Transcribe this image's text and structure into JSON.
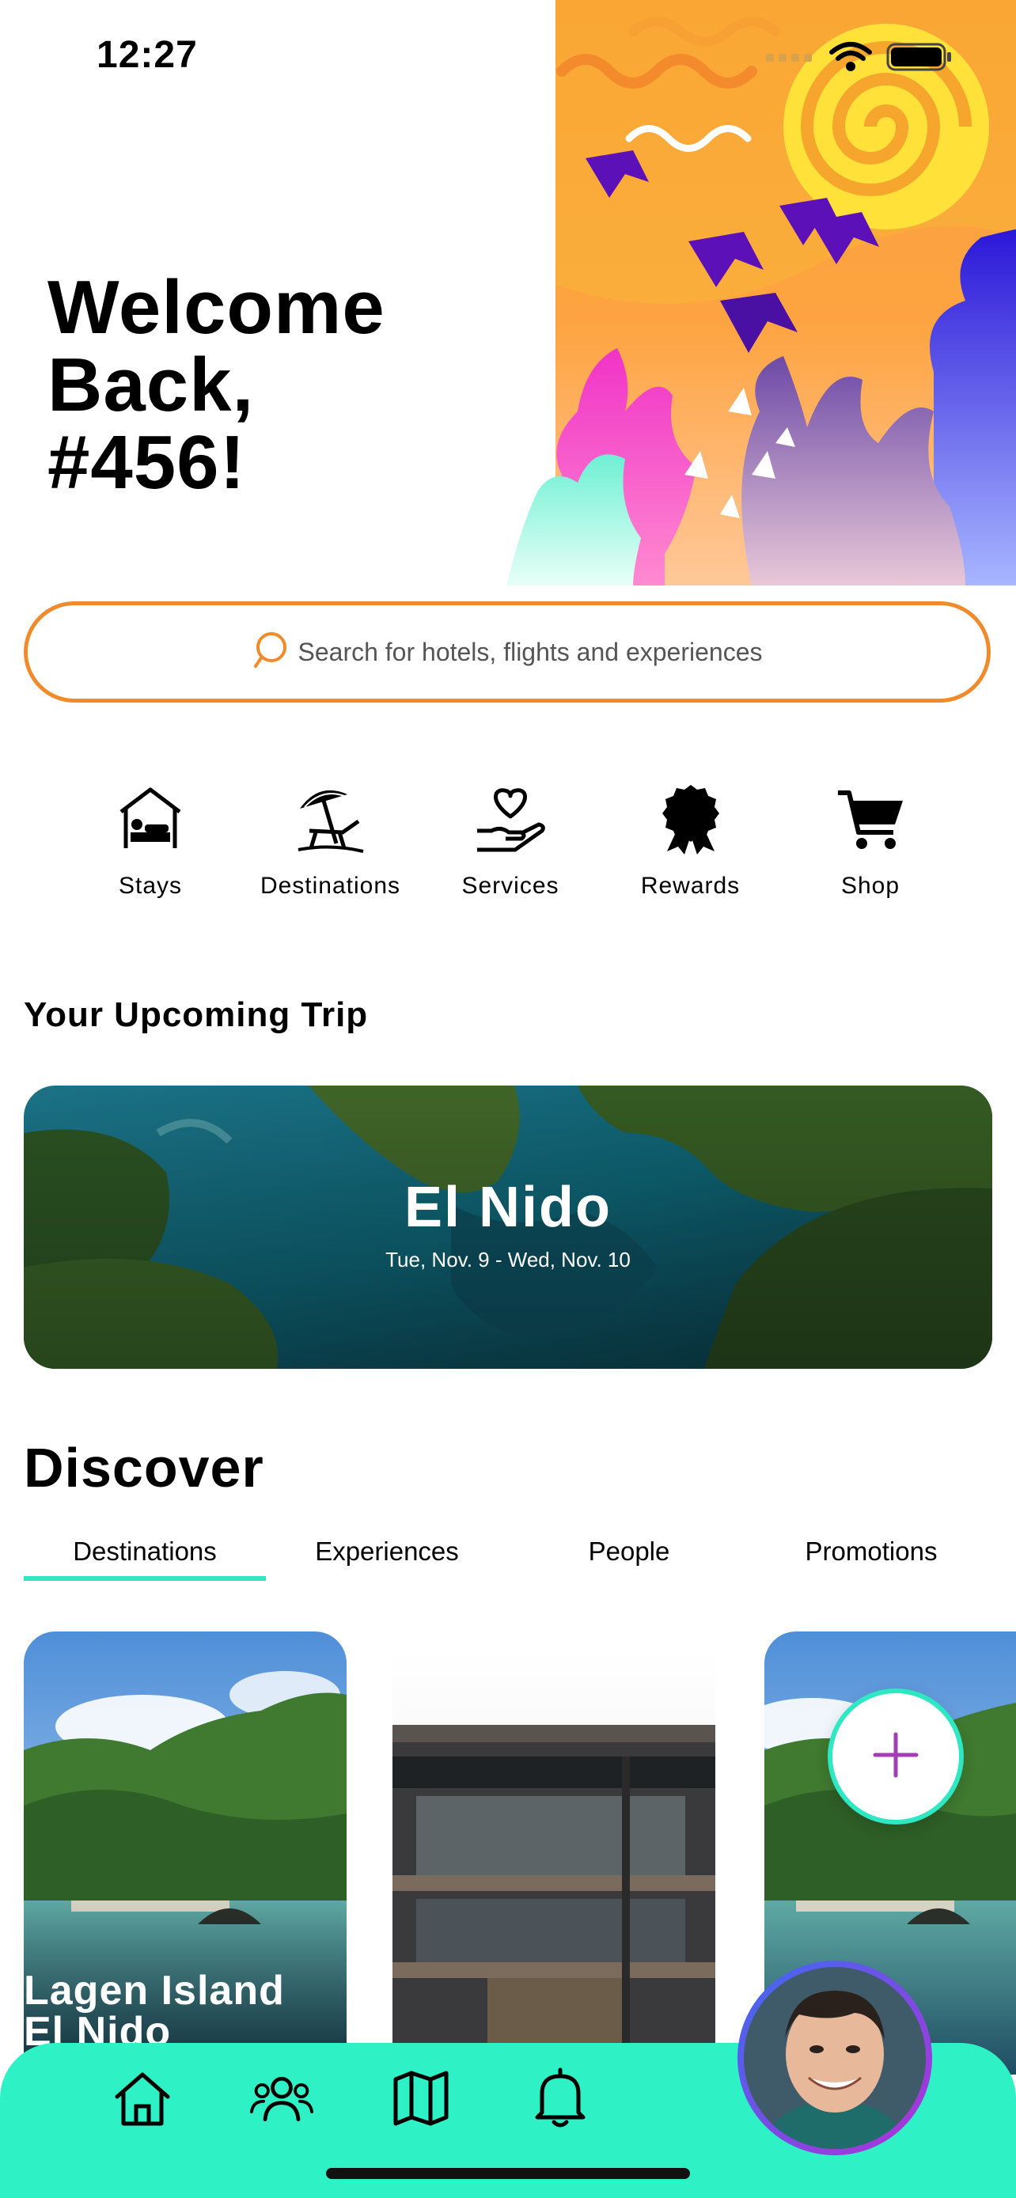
{
  "status_bar": {
    "time": "12:27"
  },
  "header": {
    "welcome_line1": "Welcome",
    "welcome_line2": "Back,",
    "welcome_line3": "#456!"
  },
  "search": {
    "placeholder": "Search for hotels, flights and experiences"
  },
  "categories": [
    {
      "label": "Stays",
      "icon": "bed-house-icon"
    },
    {
      "label": "Destinations",
      "icon": "beach-umbrella-icon"
    },
    {
      "label": "Services",
      "icon": "heart-hand-icon"
    },
    {
      "label": "Rewards",
      "icon": "award-ribbon-icon"
    },
    {
      "label": "Shop",
      "icon": "cart-icon"
    }
  ],
  "upcoming": {
    "section_title": "Your Upcoming Trip",
    "destination": "El Nido",
    "dates": "Tue, Nov. 9 - Wed, Nov. 10"
  },
  "discover": {
    "title": "Discover",
    "tabs": [
      "Destinations",
      "Experiences",
      "People",
      "Promotions"
    ],
    "active_tab": "Destinations",
    "cards": [
      {
        "title_line1": "Lagen Island",
        "title_line2": "El Nido"
      }
    ]
  },
  "tab_bar": {
    "icons": [
      "home-icon",
      "people-icon",
      "map-icon",
      "bell-icon"
    ]
  },
  "colors": {
    "accent_orange": "#f08a2a",
    "accent_teal": "#2ef2c6",
    "active_tab_underline": "#2de8c3",
    "fab_plus": "#a33fb4"
  }
}
